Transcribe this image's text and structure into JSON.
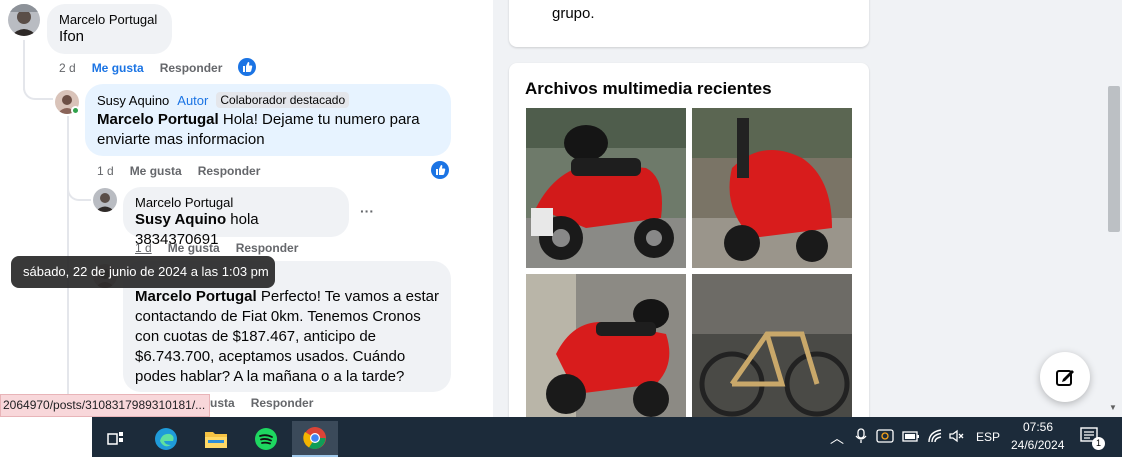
{
  "comments": [
    {
      "author": "Marcelo Portugal",
      "text": "Ifon",
      "time": "2 d",
      "like_label": "Me gusta",
      "reply_label": "Responder"
    },
    {
      "author": "Susy Aquino",
      "author_badge": "Autor",
      "role_badge": "Colaborador destacado",
      "mention": "Marcelo Portugal",
      "text": " Hola! Dejame tu numero para enviarte mas informacion",
      "time": "1 d",
      "like_label": "Me gusta",
      "reply_label": "Responder"
    },
    {
      "author": "Marcelo Portugal",
      "mention": "Susy Aquino",
      "text": " hola 3834370691",
      "time": "1 d",
      "like_label": "Me gusta",
      "reply_label": "Responder",
      "more_label": "···"
    },
    {
      "mention": "Marcelo Portugal",
      "text": " Perfecto! Te vamos a estar contactando de Fiat 0km. Tenemos Cronos con cuotas de $187.467, anticipo de $6.743.700, aceptamos usados. Cuándo podes hablar? A la mañana o a la tarde?",
      "like_label": "usta",
      "reply_label": "Responder"
    }
  ],
  "tooltip": "sábado, 22 de junio de 2024 a las 1:03 pm",
  "status_url": "2064970/posts/3108317989310181/...",
  "sidebar": {
    "about_text": "grupo.",
    "media_title": "Archivos multimedia recientes"
  },
  "taskbar": {
    "language": "ESP",
    "time": "07:56",
    "date": "24/6/2024",
    "notification_count": "1"
  },
  "colors": {
    "accent": "#1b74e4",
    "highlight_bubble": "#e7f3ff",
    "taskbar": "#1c2b3a"
  }
}
